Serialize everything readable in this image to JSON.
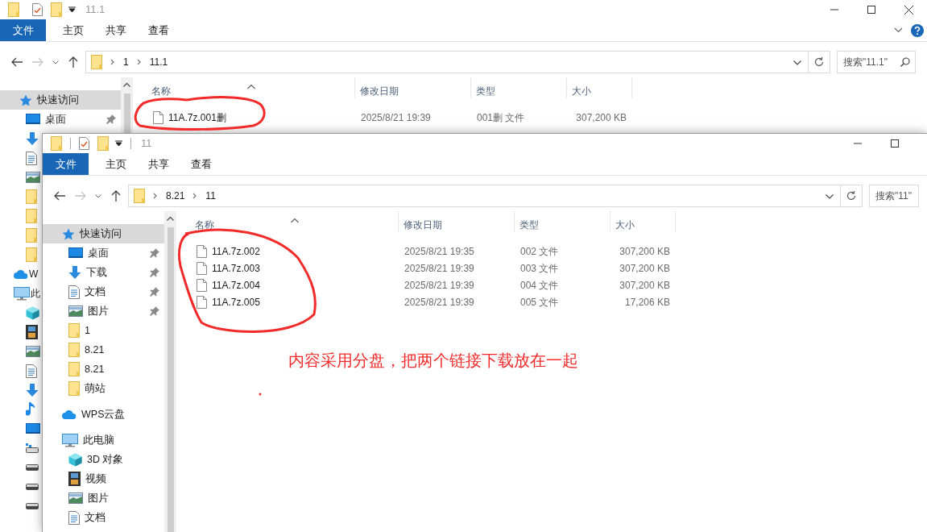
{
  "back_window": {
    "title": "11.1",
    "ribbon_tabs": [
      "文件",
      "主页",
      "共享",
      "查看"
    ],
    "breadcrumb": [
      "1",
      "11.1"
    ],
    "search": {
      "placeholder": "搜索\"11.1\""
    },
    "nav": [
      {
        "label": "快速访问",
        "kind": "quick",
        "selected": true,
        "children": [
          {
            "label": "桌面",
            "kind": "desktop",
            "pinned": true,
            "selected": false
          }
        ]
      }
    ],
    "nav_partial_labels": [
      "W",
      "此"
    ],
    "columns": [
      "名称",
      "修改日期",
      "类型",
      "大小"
    ],
    "files": [
      {
        "name": "11A.7z.001删",
        "modified": "2025/8/21 19:39",
        "type": "001删 文件",
        "size": "307,200 KB"
      }
    ]
  },
  "front_window": {
    "title": "11",
    "ribbon_tabs": [
      "文件",
      "主页",
      "共享",
      "查看"
    ],
    "breadcrumb": [
      "8.21",
      "11"
    ],
    "search": {
      "placeholder": "搜索\"11\""
    },
    "nav": [
      {
        "label": "快速访问",
        "kind": "quick",
        "selected": true,
        "children": [
          {
            "label": "桌面",
            "kind": "desktop",
            "pinned": true,
            "selected": false
          },
          {
            "label": "下载",
            "kind": "download",
            "pinned": true,
            "selected": false
          },
          {
            "label": "文档",
            "kind": "document",
            "pinned": true,
            "selected": false
          },
          {
            "label": "图片",
            "kind": "picture",
            "pinned": true,
            "selected": false
          },
          {
            "label": "1",
            "kind": "folder",
            "pinned": false,
            "selected": false
          },
          {
            "label": "8.21",
            "kind": "folder",
            "pinned": false,
            "selected": false
          },
          {
            "label": "8.21",
            "kind": "folder",
            "pinned": false,
            "selected": false
          },
          {
            "label": "萌站",
            "kind": "folder",
            "pinned": false,
            "selected": false
          }
        ]
      },
      {
        "label": "WPS云盘",
        "kind": "cloud",
        "selected": false
      },
      {
        "label": "此电脑",
        "kind": "pc",
        "selected": false,
        "children": [
          {
            "label": "3D 对象",
            "kind": "cube",
            "selected": false
          },
          {
            "label": "视频",
            "kind": "video",
            "selected": false
          },
          {
            "label": "图片",
            "kind": "picture",
            "selected": false
          },
          {
            "label": "文档",
            "kind": "document",
            "selected": false
          }
        ]
      }
    ],
    "columns": [
      "名称",
      "修改日期",
      "类型",
      "大小"
    ],
    "files": [
      {
        "name": "11A.7z.002",
        "modified": "2025/8/21 19:35",
        "type": "002 文件",
        "size": "307,200 KB"
      },
      {
        "name": "11A.7z.003",
        "modified": "2025/8/21 19:39",
        "type": "003 文件",
        "size": "307,200 KB"
      },
      {
        "name": "11A.7z.004",
        "modified": "2025/8/21 19:39",
        "type": "004 文件",
        "size": "307,200 KB"
      },
      {
        "name": "11A.7z.005",
        "modified": "2025/8/21 19:39",
        "type": "005 文件",
        "size": "17,206 KB"
      }
    ]
  },
  "annotation": {
    "text": "内容采用分盘，把两个链接下载放在一起"
  }
}
